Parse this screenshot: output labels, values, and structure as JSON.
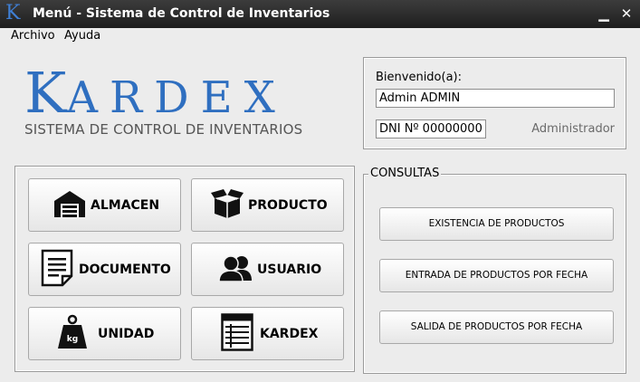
{
  "window": {
    "app_icon": "K",
    "title": "Menú - Sistema de Control de Inventarios",
    "minimize_glyph": "▁",
    "close_glyph": "✕"
  },
  "menu": {
    "items": [
      {
        "label": "Archivo"
      },
      {
        "label": "Ayuda"
      }
    ]
  },
  "logo": {
    "title_first": "K",
    "title_rest": "ARDEX",
    "subtitle": "SISTEMA DE CONTROL DE INVENTARIOS",
    "brand_color": "#2f6fc0"
  },
  "user": {
    "welcome_label": "Bienvenido(a):",
    "name_value": "Admin ADMIN",
    "dni_value": "DNI Nº 00000000",
    "role": "Administrador"
  },
  "modules": {
    "almacen": {
      "label": "ALMACEN",
      "icon": "warehouse-icon"
    },
    "producto": {
      "label": "PRODUCTO",
      "icon": "box-icon"
    },
    "documento": {
      "label": "DOCUMENTO",
      "icon": "document-icon"
    },
    "usuario": {
      "label": "USUARIO",
      "icon": "users-icon"
    },
    "unidad": {
      "label": "UNIDAD",
      "icon": "weight-icon",
      "icon_text": "kg"
    },
    "kardex": {
      "label": "KARDEX",
      "icon": "ledger-icon"
    }
  },
  "consultas": {
    "legend": "CONSULTAS",
    "buttons": [
      {
        "label": "EXISTENCIA DE PRODUCTOS"
      },
      {
        "label": "ENTRADA DE PRODUCTOS POR FECHA"
      },
      {
        "label": "SALIDA DE PRODUCTOS POR FECHA"
      }
    ]
  }
}
